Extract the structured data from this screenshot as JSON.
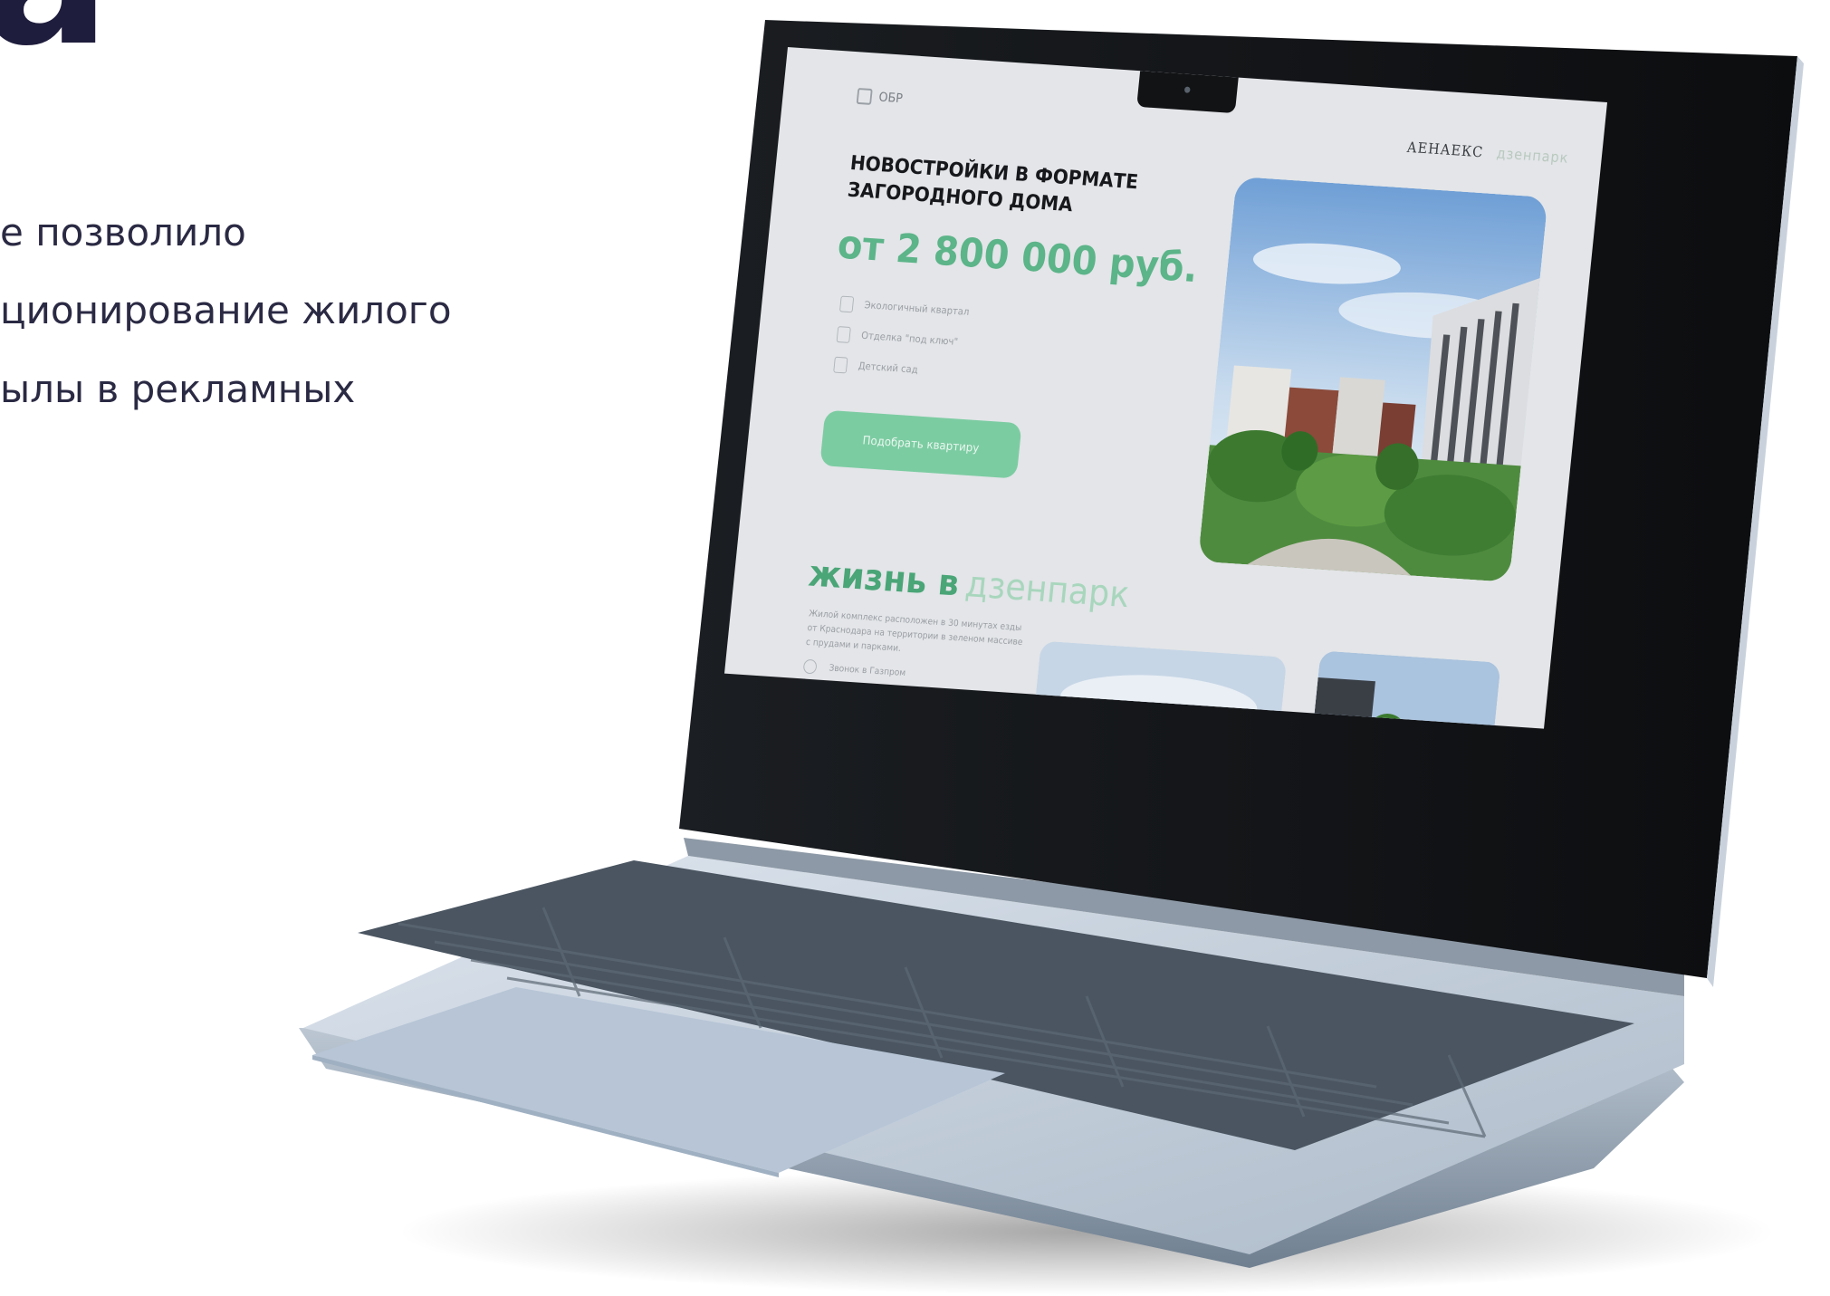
{
  "slide": {
    "heading_fragment": "а",
    "lines": [
      "е позволило",
      "ционирование жилого",
      "ылы в рекламных"
    ]
  },
  "site": {
    "logo_left": "ОБР",
    "logo_right": "АЕНАЕКС",
    "logo_right_ghost": "дзенпарк",
    "hero_title": "НОВОСТРОЙКИ В ФОРМАТЕ ЗАГОРОДНОГО ДОМА",
    "price": "от 2 800 000 руб.",
    "features": [
      "Экологичный квартал",
      "Отделка \"под ключ\"",
      "Детский сад"
    ],
    "cta_label": "Подобрать квартиру",
    "life_title": "жизнь в",
    "life_title_brand": "дзенпарк",
    "life_text": "Жилой комплекс расположен в 30 минутах езды от Краснодара на территории в зеленом массиве с прудами и парками.",
    "location_label": "Звонок в Газпром"
  },
  "colors": {
    "accent_green": "#5cb489",
    "cta_green": "#7ccca2",
    "slide_text": "#2b2a44",
    "screen_bg": "#e3e5e8"
  }
}
